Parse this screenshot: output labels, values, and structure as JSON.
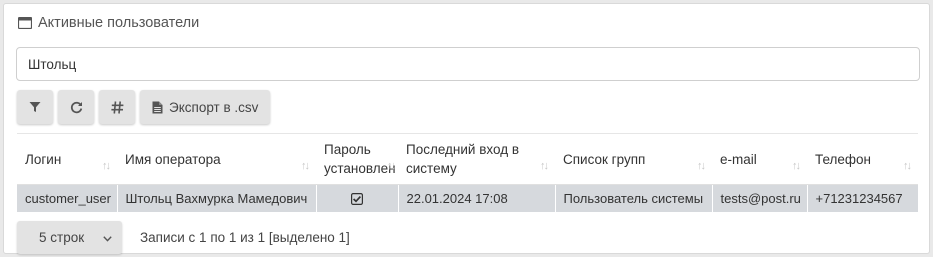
{
  "header": {
    "title": "Активные пользователи",
    "icon": "window-icon"
  },
  "search": {
    "value": "Штольц"
  },
  "toolbar": {
    "filter_icon": "filter-icon",
    "refresh_icon": "refresh-icon",
    "hash_icon": "hash-icon",
    "export_label": "Экспорт в .csv",
    "export_icon": "file-icon"
  },
  "table": {
    "columns": [
      "Логин",
      "Имя оператора",
      "Пароль установлен",
      "Последний вход в систему",
      "Список групп",
      "e-mail",
      "Телефон"
    ],
    "rows": [
      {
        "login": "customer_user",
        "name": "Штольц Вахмурка Мамедович",
        "password_set": true,
        "last_login": "22.01.2024 17:08",
        "groups": "Пользователь системы",
        "email": "tests@post.ru",
        "phone": "+71231234567"
      }
    ],
    "selected_row_color": "#d6d9dd"
  },
  "footer": {
    "page_size": "5 строк",
    "info": "Записи с 1 по 1 из 1 [выделено 1]"
  }
}
